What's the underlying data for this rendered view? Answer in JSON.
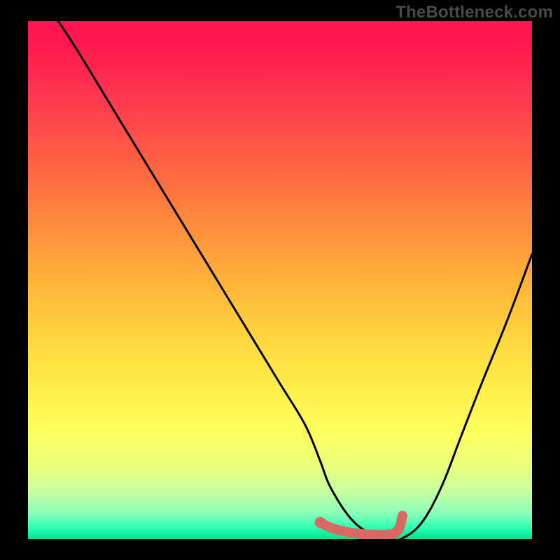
{
  "attribution": "TheBottleneck.com",
  "chart_data": {
    "type": "line",
    "title": "",
    "xlabel": "",
    "ylabel": "",
    "xlim": [
      0,
      100
    ],
    "ylim": [
      0,
      100
    ],
    "series": [
      {
        "name": "bottleneck-curve",
        "x": [
          6,
          10,
          15,
          20,
          25,
          30,
          35,
          40,
          45,
          50,
          55,
          58,
          60,
          64,
          68,
          72,
          74,
          78,
          82,
          86,
          90,
          95,
          100
        ],
        "y": [
          100,
          94,
          86,
          78,
          70,
          62,
          54,
          46,
          38,
          30,
          22,
          15,
          10,
          4,
          1,
          0,
          0,
          3,
          10,
          20,
          30,
          42,
          55
        ]
      }
    ],
    "highlight_segment": {
      "name": "optimal-range",
      "x": [
        58,
        60,
        63,
        66,
        69,
        72,
        73.5,
        74,
        74.3
      ],
      "y": [
        3.2,
        2.2,
        1.4,
        1,
        0.8,
        0.9,
        1.8,
        3.2,
        4.5
      ]
    },
    "highlight_start_point": {
      "x": 58,
      "y": 3.2
    },
    "gradient_meaning": "vertical color scale from red (high bottleneck) at top to green (no bottleneck) at bottom",
    "colors": {
      "curve": "#000000",
      "highlight": "#d86a63",
      "bg_top": "#ff1450",
      "bg_mid": "#ffe84a",
      "bg_bottom": "#00e090",
      "frame": "#000000"
    }
  }
}
